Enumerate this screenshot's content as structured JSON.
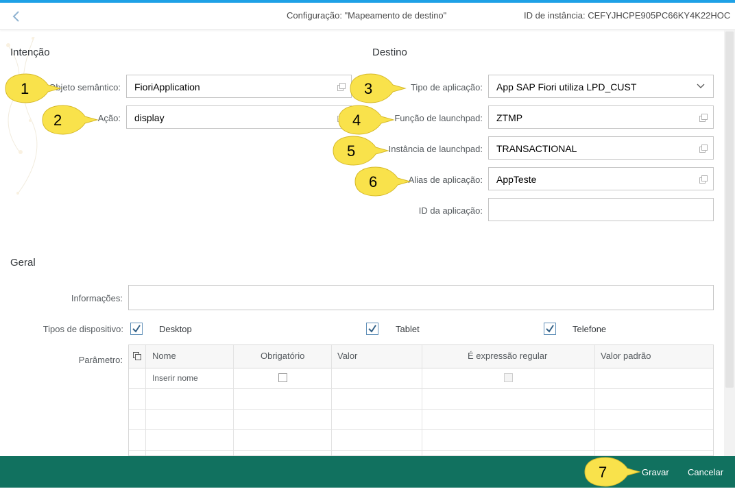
{
  "header": {
    "title": "Configuração: \"Mapeamento de destino\"",
    "instance_id": "ID de instância: CEFYJHCPE905PC66KY4K22HOC"
  },
  "intent": {
    "section_title": "Intenção",
    "semantic_object": {
      "label": "Objeto semântico:",
      "value": "FioriApplication"
    },
    "action": {
      "label": "Ação:",
      "value": "display"
    }
  },
  "target": {
    "section_title": "Destino",
    "app_type": {
      "label": "Tipo de aplicação:",
      "value": "App SAP Fiori utiliza LPD_CUST"
    },
    "launchpad_role": {
      "label": "Função de launchpad:",
      "value": "ZTMP"
    },
    "launchpad_instance": {
      "label": "Instância de launchpad:",
      "value": "TRANSACTIONAL"
    },
    "app_alias": {
      "label": "Alias de aplicação:",
      "value": "AppTeste"
    },
    "app_id": {
      "label": "ID da aplicação:",
      "value": ""
    }
  },
  "general": {
    "section_title": "Geral",
    "info": {
      "label": "Informações:",
      "value": ""
    },
    "device_types": {
      "label": "Tipos de dispositivo:",
      "desktop": "Desktop",
      "tablet": "Tablet",
      "phone": "Telefone",
      "checked": [
        true,
        true,
        true
      ]
    },
    "parameters": {
      "label": "Parâmetro:",
      "columns": [
        "Nome",
        "Obrigatório",
        "Valor",
        "É expressão regular",
        "Valor padrão"
      ],
      "first_row_placeholder": "Inserir nome"
    }
  },
  "footer": {
    "save": "Gravar",
    "cancel": "Cancelar"
  },
  "callouts": [
    "1",
    "2",
    "3",
    "4",
    "5",
    "6",
    "7"
  ],
  "colors": {
    "accent": "#1ea1e6",
    "footer": "#11715f",
    "callout": "#f9e24b",
    "checkbox": "#346187"
  }
}
